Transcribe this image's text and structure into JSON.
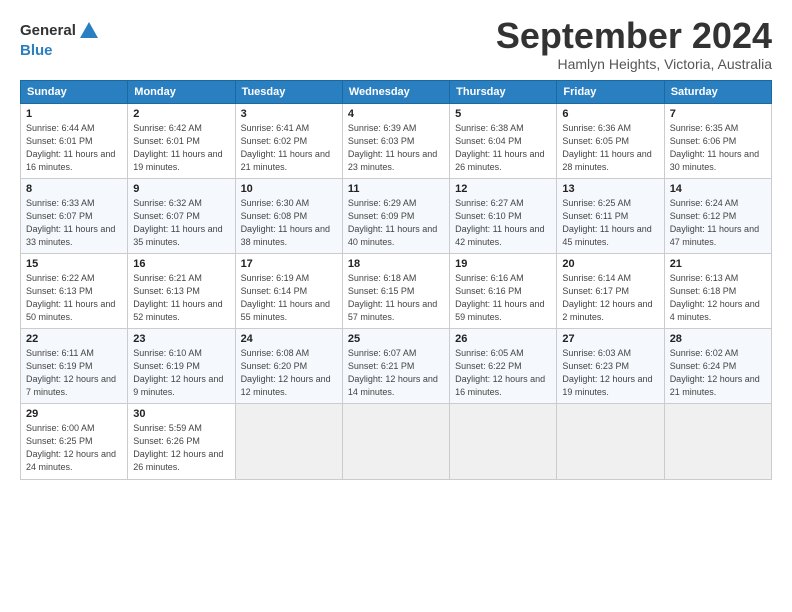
{
  "header": {
    "logo_general": "General",
    "logo_blue": "Blue",
    "title": "September 2024",
    "subtitle": "Hamlyn Heights, Victoria, Australia"
  },
  "columns": [
    "Sunday",
    "Monday",
    "Tuesday",
    "Wednesday",
    "Thursday",
    "Friday",
    "Saturday"
  ],
  "weeks": [
    [
      {
        "day": "1",
        "sunrise": "6:44 AM",
        "sunset": "6:01 PM",
        "daylight": "11 hours and 16 minutes."
      },
      {
        "day": "2",
        "sunrise": "6:42 AM",
        "sunset": "6:01 PM",
        "daylight": "11 hours and 19 minutes."
      },
      {
        "day": "3",
        "sunrise": "6:41 AM",
        "sunset": "6:02 PM",
        "daylight": "11 hours and 21 minutes."
      },
      {
        "day": "4",
        "sunrise": "6:39 AM",
        "sunset": "6:03 PM",
        "daylight": "11 hours and 23 minutes."
      },
      {
        "day": "5",
        "sunrise": "6:38 AM",
        "sunset": "6:04 PM",
        "daylight": "11 hours and 26 minutes."
      },
      {
        "day": "6",
        "sunrise": "6:36 AM",
        "sunset": "6:05 PM",
        "daylight": "11 hours and 28 minutes."
      },
      {
        "day": "7",
        "sunrise": "6:35 AM",
        "sunset": "6:06 PM",
        "daylight": "11 hours and 30 minutes."
      }
    ],
    [
      {
        "day": "8",
        "sunrise": "6:33 AM",
        "sunset": "6:07 PM",
        "daylight": "11 hours and 33 minutes."
      },
      {
        "day": "9",
        "sunrise": "6:32 AM",
        "sunset": "6:07 PM",
        "daylight": "11 hours and 35 minutes."
      },
      {
        "day": "10",
        "sunrise": "6:30 AM",
        "sunset": "6:08 PM",
        "daylight": "11 hours and 38 minutes."
      },
      {
        "day": "11",
        "sunrise": "6:29 AM",
        "sunset": "6:09 PM",
        "daylight": "11 hours and 40 minutes."
      },
      {
        "day": "12",
        "sunrise": "6:27 AM",
        "sunset": "6:10 PM",
        "daylight": "11 hours and 42 minutes."
      },
      {
        "day": "13",
        "sunrise": "6:25 AM",
        "sunset": "6:11 PM",
        "daylight": "11 hours and 45 minutes."
      },
      {
        "day": "14",
        "sunrise": "6:24 AM",
        "sunset": "6:12 PM",
        "daylight": "11 hours and 47 minutes."
      }
    ],
    [
      {
        "day": "15",
        "sunrise": "6:22 AM",
        "sunset": "6:13 PM",
        "daylight": "11 hours and 50 minutes."
      },
      {
        "day": "16",
        "sunrise": "6:21 AM",
        "sunset": "6:13 PM",
        "daylight": "11 hours and 52 minutes."
      },
      {
        "day": "17",
        "sunrise": "6:19 AM",
        "sunset": "6:14 PM",
        "daylight": "11 hours and 55 minutes."
      },
      {
        "day": "18",
        "sunrise": "6:18 AM",
        "sunset": "6:15 PM",
        "daylight": "11 hours and 57 minutes."
      },
      {
        "day": "19",
        "sunrise": "6:16 AM",
        "sunset": "6:16 PM",
        "daylight": "11 hours and 59 minutes."
      },
      {
        "day": "20",
        "sunrise": "6:14 AM",
        "sunset": "6:17 PM",
        "daylight": "12 hours and 2 minutes."
      },
      {
        "day": "21",
        "sunrise": "6:13 AM",
        "sunset": "6:18 PM",
        "daylight": "12 hours and 4 minutes."
      }
    ],
    [
      {
        "day": "22",
        "sunrise": "6:11 AM",
        "sunset": "6:19 PM",
        "daylight": "12 hours and 7 minutes."
      },
      {
        "day": "23",
        "sunrise": "6:10 AM",
        "sunset": "6:19 PM",
        "daylight": "12 hours and 9 minutes."
      },
      {
        "day": "24",
        "sunrise": "6:08 AM",
        "sunset": "6:20 PM",
        "daylight": "12 hours and 12 minutes."
      },
      {
        "day": "25",
        "sunrise": "6:07 AM",
        "sunset": "6:21 PM",
        "daylight": "12 hours and 14 minutes."
      },
      {
        "day": "26",
        "sunrise": "6:05 AM",
        "sunset": "6:22 PM",
        "daylight": "12 hours and 16 minutes."
      },
      {
        "day": "27",
        "sunrise": "6:03 AM",
        "sunset": "6:23 PM",
        "daylight": "12 hours and 19 minutes."
      },
      {
        "day": "28",
        "sunrise": "6:02 AM",
        "sunset": "6:24 PM",
        "daylight": "12 hours and 21 minutes."
      }
    ],
    [
      {
        "day": "29",
        "sunrise": "6:00 AM",
        "sunset": "6:25 PM",
        "daylight": "12 hours and 24 minutes."
      },
      {
        "day": "30",
        "sunrise": "5:59 AM",
        "sunset": "6:26 PM",
        "daylight": "12 hours and 26 minutes."
      },
      {
        "day": "",
        "sunrise": "",
        "sunset": "",
        "daylight": ""
      },
      {
        "day": "",
        "sunrise": "",
        "sunset": "",
        "daylight": ""
      },
      {
        "day": "",
        "sunrise": "",
        "sunset": "",
        "daylight": ""
      },
      {
        "day": "",
        "sunrise": "",
        "sunset": "",
        "daylight": ""
      },
      {
        "day": "",
        "sunrise": "",
        "sunset": "",
        "daylight": ""
      }
    ]
  ]
}
